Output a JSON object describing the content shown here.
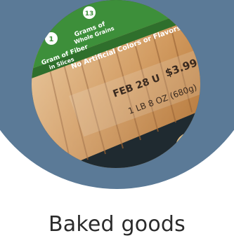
{
  "caption": "Baked goods",
  "product_photo": {
    "subject": "sliced-bread-loaf-in-plastic-bag",
    "label_texts": {
      "fiber_count": "1",
      "fiber_line1": "Gram of Fiber",
      "fiber_line2": "in Slices",
      "grains_count": "13",
      "grains_line1": "Grams of",
      "grains_line2": "Whole Grains",
      "no_artificial": "No Artificial Colors or Flavors",
      "best_by": "FEB 28 U",
      "price": "$3.99",
      "weight": "1 LB 8 OZ (680g)"
    }
  },
  "colors": {
    "background": "#ffffff",
    "blob": "#5b7a97",
    "bag_green": "#3d8f3a",
    "bread_crust": "#c98a45",
    "caption_text": "#2b2b2b"
  }
}
